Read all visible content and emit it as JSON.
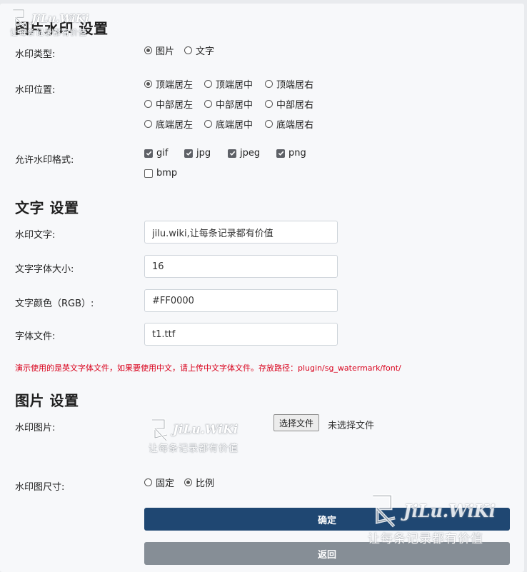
{
  "watermark_section": {
    "title": "图片水印 设置",
    "type": {
      "label": "水印类型:",
      "options": [
        "图片",
        "文字"
      ],
      "selected": 0
    },
    "position": {
      "label": "水印位置:",
      "options": [
        "顶端居左",
        "顶端居中",
        "顶端居右",
        "中部居左",
        "中部居中",
        "中部居右",
        "底端居左",
        "底端居中",
        "底端居右"
      ],
      "selected": 0
    },
    "formats": {
      "label": "允许水印格式:",
      "options": [
        {
          "label": "gif",
          "checked": true
        },
        {
          "label": "jpg",
          "checked": true
        },
        {
          "label": "jpeg",
          "checked": true
        },
        {
          "label": "png",
          "checked": true
        },
        {
          "label": "bmp",
          "checked": false
        }
      ]
    }
  },
  "text_section": {
    "title": "文字 设置",
    "watermark_text": {
      "label": "水印文字:",
      "value": "jilu.wiki,让每条记录都有价值"
    },
    "font_size": {
      "label": "文字字体大小:",
      "value": "16"
    },
    "color": {
      "label": "文字颜色（RGB）:",
      "value": "#FF0000"
    },
    "font_file": {
      "label": "字体文件:",
      "value": "t1.ttf"
    },
    "note": "演示使用的是英文字体文件，如果要使用中文，请上传中文字体文件。存放路径：plugin/sg_watermark/font/"
  },
  "image_section": {
    "title": "图片 设置",
    "image": {
      "label": "水印图片:",
      "choose_button": "选择文件",
      "no_file": "未选择文件"
    },
    "size": {
      "label": "水印图尺寸:",
      "options": [
        "固定",
        "比例"
      ],
      "selected": 1
    }
  },
  "actions": {
    "confirm": "确定",
    "back": "返回"
  },
  "watermark": {
    "logo": "JiLu.WiKi",
    "slogan": "让每条记录都有价值"
  },
  "colors": {
    "primary": "#1f4772",
    "secondary": "#868e96",
    "note": "#d9001b"
  },
  "icons": {
    "logo_mark": "stamp-logo-icon",
    "check": "check-icon"
  }
}
